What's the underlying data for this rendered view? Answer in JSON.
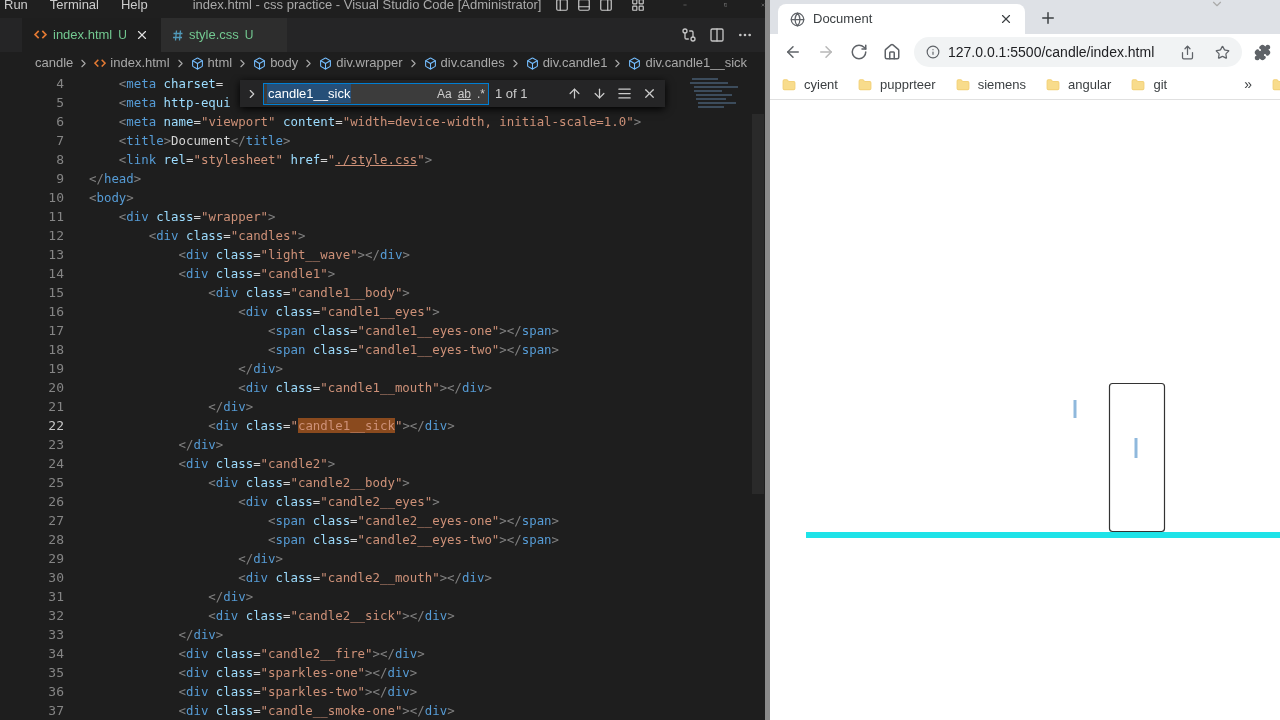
{
  "vscode": {
    "menu": [
      "Run",
      "Terminal",
      "Help"
    ],
    "title": "index.html - css practice - Visual Studio Code [Administrator]",
    "tabs": [
      {
        "label": "index.html",
        "status": "U",
        "kind": "html",
        "selected": true
      },
      {
        "label": "style.css",
        "status": "U",
        "kind": "css",
        "selected": false
      }
    ],
    "breadcrumb": [
      {
        "label": "candle",
        "kind": "folder"
      },
      {
        "label": "index.html",
        "kind": "file"
      },
      {
        "label": "html",
        "kind": "element"
      },
      {
        "label": "body",
        "kind": "element"
      },
      {
        "label": "div.wrapper",
        "kind": "element"
      },
      {
        "label": "div.candles",
        "kind": "element"
      },
      {
        "label": "div.candle1",
        "kind": "element"
      },
      {
        "label": "div.candle1__sick",
        "kind": "element"
      }
    ],
    "find": {
      "value": "candle1__sick",
      "options": [
        {
          "label": "Aa",
          "on": false
        },
        {
          "label": "ab",
          "on": false
        },
        {
          "label": ".*",
          "on": false
        }
      ],
      "count": "1 of 1"
    },
    "lines": [
      {
        "number": "4",
        "current": false,
        "tokens": [
          {
            "kind": "p",
            "text": "    <"
          },
          {
            "kind": "tag",
            "text": "meta"
          },
          {
            "kind": "attr",
            "text": " charset"
          },
          {
            "kind": "eq",
            "text": "="
          }
        ]
      },
      {
        "number": "5",
        "current": false,
        "tokens": [
          {
            "kind": "p",
            "text": "    <"
          },
          {
            "kind": "tag",
            "text": "meta"
          },
          {
            "kind": "attr",
            "text": " http-equi"
          }
        ]
      },
      {
        "number": "6",
        "current": false,
        "tokens": [
          {
            "kind": "p",
            "text": "    <"
          },
          {
            "kind": "tag",
            "text": "meta"
          },
          {
            "kind": "attr",
            "text": " name"
          },
          {
            "kind": "eq",
            "text": "="
          },
          {
            "kind": "str",
            "text": "\"viewport\""
          },
          {
            "kind": "attr",
            "text": " content"
          },
          {
            "kind": "eq",
            "text": "="
          },
          {
            "kind": "str",
            "text": "\"width=device-width, initial-scale=1.0\""
          },
          {
            "kind": "p",
            "text": ">"
          }
        ]
      },
      {
        "number": "7",
        "current": false,
        "tokens": [
          {
            "kind": "p",
            "text": "    <"
          },
          {
            "kind": "tag",
            "text": "title"
          },
          {
            "kind": "p",
            "text": ">"
          },
          {
            "kind": "txt",
            "text": "Document"
          },
          {
            "kind": "p",
            "text": "</"
          },
          {
            "kind": "tag",
            "text": "title"
          },
          {
            "kind": "p",
            "text": ">"
          }
        ]
      },
      {
        "number": "8",
        "current": false,
        "tokens": [
          {
            "kind": "p",
            "text": "    <"
          },
          {
            "kind": "tag",
            "text": "link"
          },
          {
            "kind": "attr",
            "text": " rel"
          },
          {
            "kind": "eq",
            "text": "="
          },
          {
            "kind": "str",
            "text": "\"stylesheet\""
          },
          {
            "kind": "attr",
            "text": " href"
          },
          {
            "kind": "eq",
            "text": "="
          },
          {
            "kind": "str",
            "text": "\""
          },
          {
            "kind": "link",
            "text": "./style.css"
          },
          {
            "kind": "str",
            "text": "\""
          },
          {
            "kind": "p",
            "text": ">"
          }
        ]
      },
      {
        "number": "9",
        "current": false,
        "tokens": [
          {
            "kind": "p",
            "text": "</"
          },
          {
            "kind": "tag",
            "text": "head"
          },
          {
            "kind": "p",
            "text": ">"
          }
        ]
      },
      {
        "number": "10",
        "current": false,
        "tokens": [
          {
            "kind": "p",
            "text": "<"
          },
          {
            "kind": "tag",
            "text": "body"
          },
          {
            "kind": "p",
            "text": ">"
          }
        ]
      },
      {
        "number": "11",
        "current": false,
        "tokens": [
          {
            "kind": "p",
            "text": "    <"
          },
          {
            "kind": "tag",
            "text": "div"
          },
          {
            "kind": "attr",
            "text": " class"
          },
          {
            "kind": "eq",
            "text": "="
          },
          {
            "kind": "str",
            "text": "\"wrapper\""
          },
          {
            "kind": "p",
            "text": ">"
          }
        ]
      },
      {
        "number": "12",
        "current": false,
        "tokens": [
          {
            "kind": "p",
            "text": "        <"
          },
          {
            "kind": "tag",
            "text": "div"
          },
          {
            "kind": "attr",
            "text": " class"
          },
          {
            "kind": "eq",
            "text": "="
          },
          {
            "kind": "str",
            "text": "\"candles\""
          },
          {
            "kind": "p",
            "text": ">"
          }
        ]
      },
      {
        "number": "13",
        "current": false,
        "tokens": [
          {
            "kind": "p",
            "text": "            <"
          },
          {
            "kind": "tag",
            "text": "div"
          },
          {
            "kind": "attr",
            "text": " class"
          },
          {
            "kind": "eq",
            "text": "="
          },
          {
            "kind": "str",
            "text": "\"light__wave\""
          },
          {
            "kind": "p",
            "text": "></"
          },
          {
            "kind": "tag",
            "text": "div"
          },
          {
            "kind": "p",
            "text": ">"
          }
        ]
      },
      {
        "number": "14",
        "current": false,
        "tokens": [
          {
            "kind": "p",
            "text": "            <"
          },
          {
            "kind": "tag",
            "text": "div"
          },
          {
            "kind": "attr",
            "text": " class"
          },
          {
            "kind": "eq",
            "text": "="
          },
          {
            "kind": "str",
            "text": "\"candle1\""
          },
          {
            "kind": "p",
            "text": ">"
          }
        ]
      },
      {
        "number": "15",
        "current": false,
        "tokens": [
          {
            "kind": "p",
            "text": "                <"
          },
          {
            "kind": "tag",
            "text": "div"
          },
          {
            "kind": "attr",
            "text": " class"
          },
          {
            "kind": "eq",
            "text": "="
          },
          {
            "kind": "str",
            "text": "\"candle1__body\""
          },
          {
            "kind": "p",
            "text": ">"
          }
        ]
      },
      {
        "number": "16",
        "current": false,
        "tokens": [
          {
            "kind": "p",
            "text": "                    <"
          },
          {
            "kind": "tag",
            "text": "div"
          },
          {
            "kind": "attr",
            "text": " class"
          },
          {
            "kind": "eq",
            "text": "="
          },
          {
            "kind": "str",
            "text": "\"candle1__eyes\""
          },
          {
            "kind": "p",
            "text": ">"
          }
        ]
      },
      {
        "number": "17",
        "current": false,
        "tokens": [
          {
            "kind": "p",
            "text": "                        <"
          },
          {
            "kind": "tag",
            "text": "span"
          },
          {
            "kind": "attr",
            "text": " class"
          },
          {
            "kind": "eq",
            "text": "="
          },
          {
            "kind": "str",
            "text": "\"candle1__eyes-one\""
          },
          {
            "kind": "p",
            "text": "></"
          },
          {
            "kind": "tag",
            "text": "span"
          },
          {
            "kind": "p",
            "text": ">"
          }
        ]
      },
      {
        "number": "18",
        "current": false,
        "tokens": [
          {
            "kind": "p",
            "text": "                        <"
          },
          {
            "kind": "tag",
            "text": "span"
          },
          {
            "kind": "attr",
            "text": " class"
          },
          {
            "kind": "eq",
            "text": "="
          },
          {
            "kind": "str",
            "text": "\"candle1__eyes-two\""
          },
          {
            "kind": "p",
            "text": "></"
          },
          {
            "kind": "tag",
            "text": "span"
          },
          {
            "kind": "p",
            "text": ">"
          }
        ]
      },
      {
        "number": "19",
        "current": false,
        "tokens": [
          {
            "kind": "p",
            "text": "                    </"
          },
          {
            "kind": "tag",
            "text": "div"
          },
          {
            "kind": "p",
            "text": ">"
          }
        ]
      },
      {
        "number": "20",
        "current": false,
        "tokens": [
          {
            "kind": "p",
            "text": "                    <"
          },
          {
            "kind": "tag",
            "text": "div"
          },
          {
            "kind": "attr",
            "text": " class"
          },
          {
            "kind": "eq",
            "text": "="
          },
          {
            "kind": "str",
            "text": "\"candle1__mouth\""
          },
          {
            "kind": "p",
            "text": "></"
          },
          {
            "kind": "tag",
            "text": "div"
          },
          {
            "kind": "p",
            "text": ">"
          }
        ]
      },
      {
        "number": "21",
        "current": false,
        "tokens": [
          {
            "kind": "p",
            "text": "                </"
          },
          {
            "kind": "tag",
            "text": "div"
          },
          {
            "kind": "p",
            "text": ">"
          }
        ]
      },
      {
        "number": "22",
        "current": true,
        "tokens": [
          {
            "kind": "p",
            "text": "                <"
          },
          {
            "kind": "tag",
            "text": "div"
          },
          {
            "kind": "attr",
            "text": " class"
          },
          {
            "kind": "eq",
            "text": "="
          },
          {
            "kind": "str",
            "text": "\""
          },
          {
            "kind": "match",
            "text": "candle1__sick"
          },
          {
            "kind": "str",
            "text": "\""
          },
          {
            "kind": "p",
            "text": "></"
          },
          {
            "kind": "tag",
            "text": "div"
          },
          {
            "kind": "p",
            "text": ">"
          }
        ]
      },
      {
        "number": "23",
        "current": false,
        "tokens": [
          {
            "kind": "p",
            "text": "            </"
          },
          {
            "kind": "tag",
            "text": "div"
          },
          {
            "kind": "p",
            "text": ">"
          }
        ]
      },
      {
        "number": "24",
        "current": false,
        "tokens": [
          {
            "kind": "p",
            "text": "            <"
          },
          {
            "kind": "tag",
            "text": "div"
          },
          {
            "kind": "attr",
            "text": " class"
          },
          {
            "kind": "eq",
            "text": "="
          },
          {
            "kind": "str",
            "text": "\"candle2\""
          },
          {
            "kind": "p",
            "text": ">"
          }
        ]
      },
      {
        "number": "25",
        "current": false,
        "tokens": [
          {
            "kind": "p",
            "text": "                <"
          },
          {
            "kind": "tag",
            "text": "div"
          },
          {
            "kind": "attr",
            "text": " class"
          },
          {
            "kind": "eq",
            "text": "="
          },
          {
            "kind": "str",
            "text": "\"candle2__body\""
          },
          {
            "kind": "p",
            "text": ">"
          }
        ]
      },
      {
        "number": "26",
        "current": false,
        "tokens": [
          {
            "kind": "p",
            "text": "                    <"
          },
          {
            "kind": "tag",
            "text": "div"
          },
          {
            "kind": "attr",
            "text": " class"
          },
          {
            "kind": "eq",
            "text": "="
          },
          {
            "kind": "str",
            "text": "\"candle2__eyes\""
          },
          {
            "kind": "p",
            "text": ">"
          }
        ]
      },
      {
        "number": "27",
        "current": false,
        "tokens": [
          {
            "kind": "p",
            "text": "                        <"
          },
          {
            "kind": "tag",
            "text": "span"
          },
          {
            "kind": "attr",
            "text": " class"
          },
          {
            "kind": "eq",
            "text": "="
          },
          {
            "kind": "str",
            "text": "\"candle2__eyes-one\""
          },
          {
            "kind": "p",
            "text": "></"
          },
          {
            "kind": "tag",
            "text": "span"
          },
          {
            "kind": "p",
            "text": ">"
          }
        ]
      },
      {
        "number": "28",
        "current": false,
        "tokens": [
          {
            "kind": "p",
            "text": "                        <"
          },
          {
            "kind": "tag",
            "text": "span"
          },
          {
            "kind": "attr",
            "text": " class"
          },
          {
            "kind": "eq",
            "text": "="
          },
          {
            "kind": "str",
            "text": "\"candle2__eyes-two\""
          },
          {
            "kind": "p",
            "text": "></"
          },
          {
            "kind": "tag",
            "text": "span"
          },
          {
            "kind": "p",
            "text": ">"
          }
        ]
      },
      {
        "number": "29",
        "current": false,
        "tokens": [
          {
            "kind": "p",
            "text": "                    </"
          },
          {
            "kind": "tag",
            "text": "div"
          },
          {
            "kind": "p",
            "text": ">"
          }
        ]
      },
      {
        "number": "30",
        "current": false,
        "tokens": [
          {
            "kind": "p",
            "text": "                    <"
          },
          {
            "kind": "tag",
            "text": "div"
          },
          {
            "kind": "attr",
            "text": " class"
          },
          {
            "kind": "eq",
            "text": "="
          },
          {
            "kind": "str",
            "text": "\"candle2__mouth\""
          },
          {
            "kind": "p",
            "text": "></"
          },
          {
            "kind": "tag",
            "text": "div"
          },
          {
            "kind": "p",
            "text": ">"
          }
        ]
      },
      {
        "number": "31",
        "current": false,
        "tokens": [
          {
            "kind": "p",
            "text": "                </"
          },
          {
            "kind": "tag",
            "text": "div"
          },
          {
            "kind": "p",
            "text": ">"
          }
        ]
      },
      {
        "number": "32",
        "current": false,
        "tokens": [
          {
            "kind": "p",
            "text": "                <"
          },
          {
            "kind": "tag",
            "text": "div"
          },
          {
            "kind": "attr",
            "text": " class"
          },
          {
            "kind": "eq",
            "text": "="
          },
          {
            "kind": "str",
            "text": "\"candle2__sick\""
          },
          {
            "kind": "p",
            "text": "></"
          },
          {
            "kind": "tag",
            "text": "div"
          },
          {
            "kind": "p",
            "text": ">"
          }
        ]
      },
      {
        "number": "33",
        "current": false,
        "tokens": [
          {
            "kind": "p",
            "text": "            </"
          },
          {
            "kind": "tag",
            "text": "div"
          },
          {
            "kind": "p",
            "text": ">"
          }
        ]
      },
      {
        "number": "34",
        "current": false,
        "tokens": [
          {
            "kind": "p",
            "text": "            <"
          },
          {
            "kind": "tag",
            "text": "div"
          },
          {
            "kind": "attr",
            "text": " class"
          },
          {
            "kind": "eq",
            "text": "="
          },
          {
            "kind": "str",
            "text": "\"candle2__fire\""
          },
          {
            "kind": "p",
            "text": "></"
          },
          {
            "kind": "tag",
            "text": "div"
          },
          {
            "kind": "p",
            "text": ">"
          }
        ]
      },
      {
        "number": "35",
        "current": false,
        "tokens": [
          {
            "kind": "p",
            "text": "            <"
          },
          {
            "kind": "tag",
            "text": "div"
          },
          {
            "kind": "attr",
            "text": " class"
          },
          {
            "kind": "eq",
            "text": "="
          },
          {
            "kind": "str",
            "text": "\"sparkles-one\""
          },
          {
            "kind": "p",
            "text": "></"
          },
          {
            "kind": "tag",
            "text": "div"
          },
          {
            "kind": "p",
            "text": ">"
          }
        ]
      },
      {
        "number": "36",
        "current": false,
        "tokens": [
          {
            "kind": "p",
            "text": "            <"
          },
          {
            "kind": "tag",
            "text": "div"
          },
          {
            "kind": "attr",
            "text": " class"
          },
          {
            "kind": "eq",
            "text": "="
          },
          {
            "kind": "str",
            "text": "\"sparkles-two\""
          },
          {
            "kind": "p",
            "text": "></"
          },
          {
            "kind": "tag",
            "text": "div"
          },
          {
            "kind": "p",
            "text": ">"
          }
        ]
      },
      {
        "number": "37",
        "current": false,
        "tokens": [
          {
            "kind": "p",
            "text": "            <"
          },
          {
            "kind": "tag",
            "text": "div"
          },
          {
            "kind": "attr",
            "text": " class"
          },
          {
            "kind": "eq",
            "text": "="
          },
          {
            "kind": "str",
            "text": "\"candle__smoke-one\""
          },
          {
            "kind": "p",
            "text": "></"
          },
          {
            "kind": "tag",
            "text": "div"
          },
          {
            "kind": "p",
            "text": ">"
          }
        ]
      }
    ]
  },
  "browser": {
    "tab": {
      "title": "Document"
    },
    "nav": [
      {
        "kind": "back",
        "disabled": false
      },
      {
        "kind": "forward",
        "disabled": true
      },
      {
        "kind": "reload",
        "disabled": false
      },
      {
        "kind": "home",
        "disabled": false
      }
    ],
    "url": "127.0.0.1:5500/candle/index.html",
    "bookmarks": [
      "cyient",
      "pupprteer",
      "siemens",
      "angular",
      "git"
    ],
    "bookmarks_overflow": "»"
  }
}
